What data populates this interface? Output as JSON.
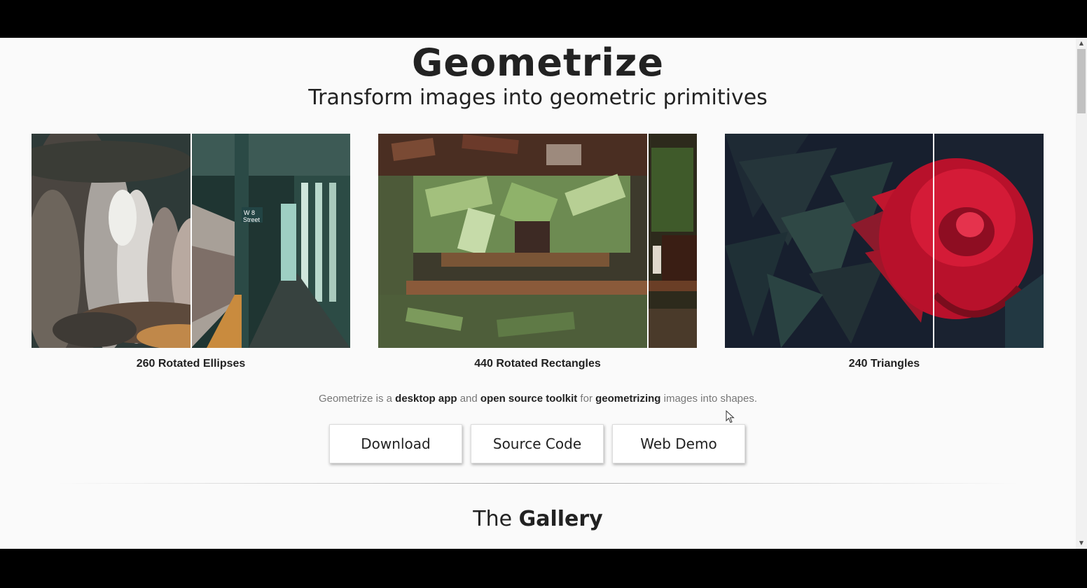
{
  "header": {
    "title": "Geometrize",
    "subtitle": "Transform images into geometric primitives"
  },
  "examples": [
    {
      "caption": "260 Rotated Ellipses",
      "icon": "subway-platform-image"
    },
    {
      "caption": "440 Rotated Rectangles",
      "icon": "forest-cafe-image"
    },
    {
      "caption": "240 Triangles",
      "icon": "red-rose-image"
    }
  ],
  "description": {
    "p1": "Geometrize is a ",
    "b1": "desktop app",
    "p2": " and ",
    "b2": "open source toolkit",
    "p3": " for ",
    "b3": "geometrizing",
    "p4": " images into shapes."
  },
  "buttons": {
    "download": "Download",
    "source_code": "Source Code",
    "web_demo": "Web Demo"
  },
  "gallery": {
    "prefix": "The ",
    "bold": "Gallery"
  },
  "colors": {
    "page_bg": "#fafafa",
    "text": "#222222",
    "muted": "#777777",
    "rose": "#c8102e"
  }
}
